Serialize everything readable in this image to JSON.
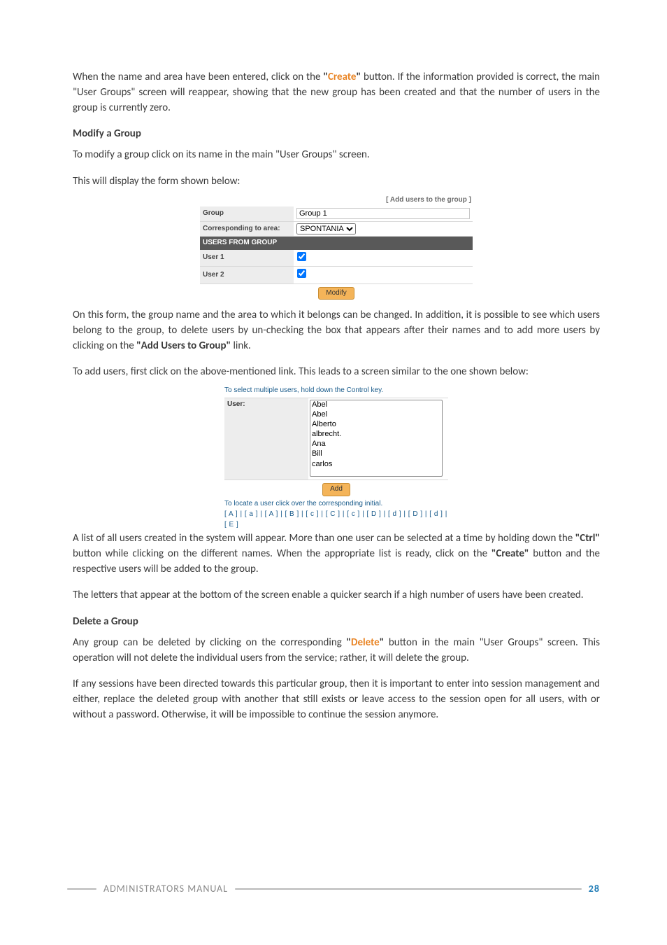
{
  "para1_a": "When the name and area have been entered, click on the ",
  "para1_b": "\"",
  "para1_create": "Create",
  "para1_c": "\"",
  "para1_d": " button. If the information provided is correct, the main \"User Groups\" screen will reappear, showing that the new group has been created and that the number of users in the group is currently zero.",
  "h_modify": "Modify a Group",
  "para2": "To modify a group click on its name in the main \"User Groups\" screen.",
  "para3": "This will display the form shown below:",
  "form1": {
    "addlink": "[ Add users to the group ]",
    "rows": {
      "group_label": "Group",
      "group_value": "Group 1",
      "area_label": "Corresponding to area:",
      "area_value": "SPONTANIA",
      "users_header": "USERS FROM GROUP",
      "user1": "User 1",
      "user2": "User 2"
    },
    "btn": "Modify"
  },
  "para4_a": "On this form, the group name and the area to which it belongs can be changed. In addition, it is possible to see which users belong to the group, to delete users by un-checking the box that appears after their names and to add more users by clicking on the ",
  "para4_b": "\"Add Users to Group\"",
  "para4_c": " link.",
  "para5": "To add users, first click on the above-mentioned link. This leads to a screen similar to the one shown below:",
  "form2": {
    "hint": "To select multiple users, hold down the Control key.",
    "label": "User:",
    "options": [
      "Abel",
      "Abel",
      "Alberto",
      "albrecht.",
      "Ana",
      "Bill",
      "carlos"
    ],
    "btn": "Add",
    "foot": "To locate a user click over the corresponding initial.",
    "letters": "[ A ] | [ a ] | [ A ] | [ B ] | [ c ] | [ C ] | [ c ] | [ D ] | [ d ] | [ D ] | [ d ] | [ E ]"
  },
  "para6_a": "A list of all users created in the system will appear. More than one user can be selected at a time by holding down the ",
  "para6_b": "\"Ctrl\"",
  "para6_c": " button while clicking on the different names. When the appropriate list is ready, click on the ",
  "para6_d": "\"Create\"",
  "para6_e": " button and the respective users will be added to the group.",
  "para7": "The letters that appear at the bottom of the screen enable a quicker search if a high number of users have been created.",
  "h_delete": "Delete a Group",
  "para8_a": "Any group can be deleted by clicking on the corresponding ",
  "para8_b": "\"",
  "para8_delete": "Delete",
  "para8_c": "\"",
  "para8_d": " button in the main \"User Groups\" screen. This operation will not delete the individual users from the service; rather, it will delete the group.",
  "para9": "If any sessions have been directed towards this particular group, then it is important to enter into session management and either, replace the deleted group with another that still exists or leave access to the session open for all users, with or without a password. Otherwise, it will be impossible to continue the session anymore.",
  "footer": {
    "title": "ADMINISTRATORS MANUAL",
    "page": "28"
  }
}
